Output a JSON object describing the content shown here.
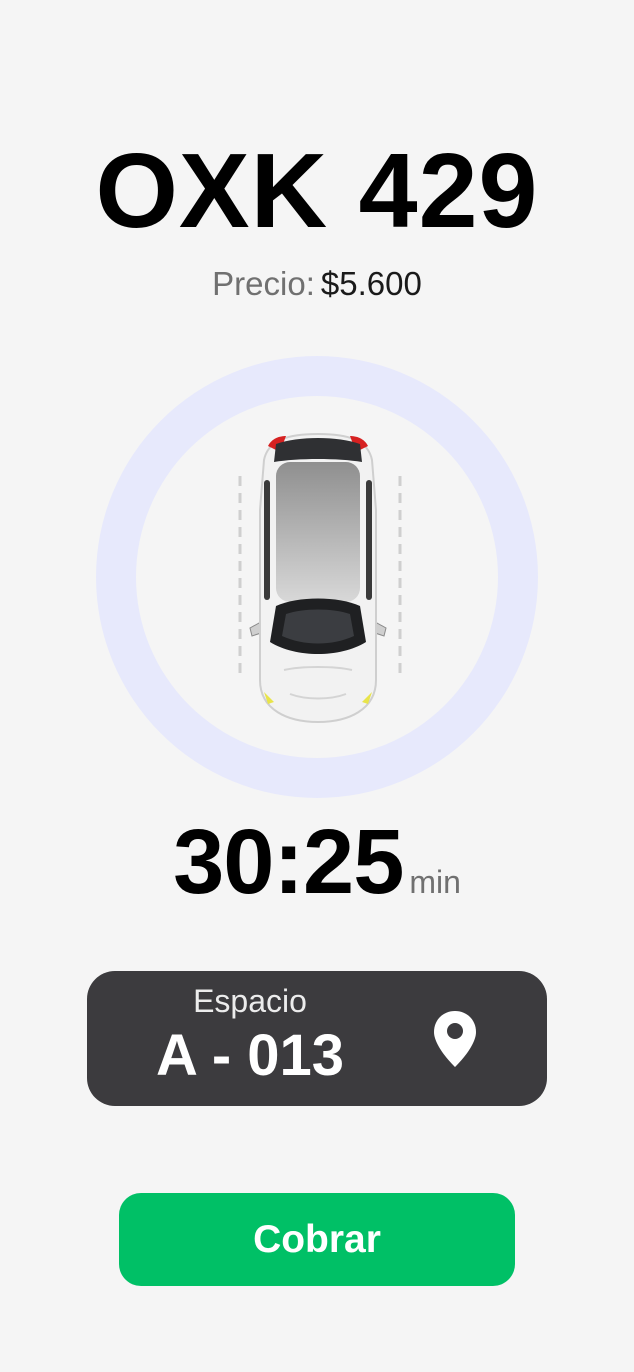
{
  "header": {
    "plate": "OXK 429",
    "price_label": "Precio:",
    "price_value": "$5.600"
  },
  "timer": {
    "value": "30:25",
    "unit": "min"
  },
  "space": {
    "label": "Espacio",
    "value": "A - 013"
  },
  "actions": {
    "cobrar_label": "Cobrar"
  },
  "colors": {
    "background": "#f5f5f5",
    "ring": "#e7e9fc",
    "card": "#3c3b3e",
    "button": "#00c066"
  },
  "icons": {
    "car": "car-top-view-icon",
    "location": "location-pin-icon"
  }
}
